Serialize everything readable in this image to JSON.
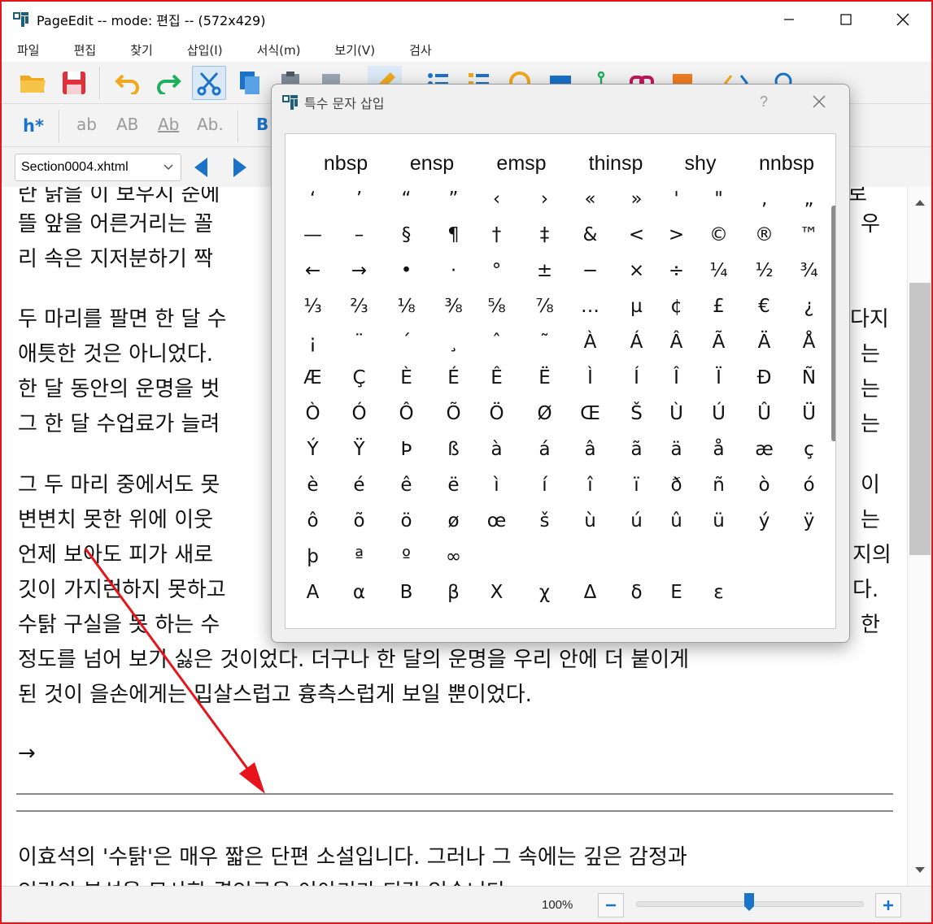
{
  "window": {
    "title": "PageEdit -- mode: 편집 -- (572x429)"
  },
  "menu": [
    "파일",
    "편집",
    "찾기",
    "삽입(I)",
    "서식(m)",
    "보기(V)",
    "검사"
  ],
  "toolbar2": {
    "heading_label": "h*",
    "case_labels": [
      "ab",
      "AB",
      "Ab",
      "Ab."
    ],
    "bold_label": "B"
  },
  "toolbar3": {
    "file_select_value": "Section0004.xhtml"
  },
  "editor": {
    "lines": [
      "란 닭을 이 보우시 순에",
      "뜰 앞을 어른거리는 꼴",
      "리 속은 지저분하기 짝",
      "두 마리를 팔면 한 달 수",
      "애틋한 것은 아니었다.",
      "한 달 동안의 운명을 벗",
      "그 한 달 수업료가 늘려",
      "그 두 마리 중에서도 못",
      "변변치 못한 위에 이웃",
      "언제 보아도 피가 새로",
      "깃이 가지런하지 못하고",
      "수탉 구실을 못 하는 수",
      "정도를 넘어 보기 싫은 것이었다. 더구나 한 달의 운명을 우리 안에 더 붙이게",
      "된 것이 을손에게는 밉살스럽고 흉측스럽게 보일 뿐이었다.",
      "→",
      "이효석의 '수탉'은 매우 짧은 단편 소설입니다. 그러나 그 속에는 깊은 감정과",
      "인간의 본성을 묘사한 결인금을 이야기가 되각 있습니다"
    ],
    "right_fragments": [
      "로",
      "우",
      "다지",
      "는",
      "는",
      "는",
      "이",
      "는",
      "지의",
      "다.",
      "한"
    ]
  },
  "status": {
    "zoom": "100%",
    "zoom_level_percent": 47
  },
  "dialog": {
    "title": "특수 문자 삽입",
    "help": "?",
    "named_entities": [
      "nbsp",
      "ensp",
      "emsp",
      "thinsp",
      "shy",
      "nnbsp"
    ],
    "rows": [
      [
        "‘",
        "’",
        "“",
        "”",
        "‹",
        "›",
        "«",
        "»",
        "'",
        "\"",
        "‚",
        "„"
      ],
      [
        "—",
        "–",
        "§",
        "¶",
        "†",
        "‡",
        "&",
        "<",
        ">",
        "©",
        "®",
        "™"
      ],
      [
        "←",
        "→",
        "•",
        "·",
        "°",
        "±",
        "−",
        "×",
        "÷",
        "¼",
        "½",
        "¾"
      ],
      [
        "⅓",
        "⅔",
        "⅛",
        "⅜",
        "⅝",
        "⅞",
        "…",
        "µ",
        "¢",
        "£",
        "€",
        "¿"
      ],
      [
        "¡",
        "¨",
        "´",
        "¸",
        "ˆ",
        "˜",
        "À",
        "Á",
        "Â",
        "Ã",
        "Ä",
        "Å"
      ],
      [
        "Æ",
        "Ç",
        "È",
        "É",
        "Ê",
        "Ë",
        "Ì",
        "Í",
        "Î",
        "Ï",
        "Ð",
        "Ñ"
      ],
      [
        "Ò",
        "Ó",
        "Ô",
        "Õ",
        "Ö",
        "Ø",
        "Œ",
        "Š",
        "Ù",
        "Ú",
        "Û",
        "Ü"
      ],
      [
        "Ý",
        "Ÿ",
        "Þ",
        "ß",
        "à",
        "á",
        "â",
        "ã",
        "ä",
        "å",
        "æ",
        "ç"
      ],
      [
        "è",
        "é",
        "ê",
        "ë",
        "ì",
        "í",
        "î",
        "ï",
        "ð",
        "ñ",
        "ò",
        "ó"
      ],
      [
        "ô",
        "õ",
        "ö",
        "ø",
        "œ",
        "š",
        "ù",
        "ú",
        "û",
        "ü",
        "ý",
        "ÿ"
      ],
      [
        "þ",
        "ª",
        "º",
        "∞"
      ],
      [
        "Α",
        "α",
        "Β",
        "β",
        "Χ",
        "χ",
        "Δ",
        "δ",
        "Ε",
        "ε"
      ]
    ]
  },
  "colors": {
    "frame_border": "#e8141b",
    "arrow": "#e8141b",
    "accent_blue": "#1a73c9"
  }
}
